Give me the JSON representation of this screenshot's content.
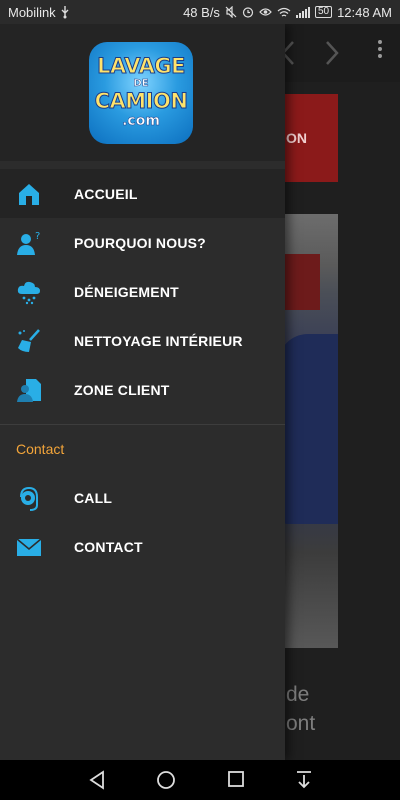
{
  "status_bar": {
    "carrier": "Mobilink",
    "speed": "48 B/s",
    "battery": "50",
    "time": "12:48 AM"
  },
  "logo": {
    "line1": "LAVAGE",
    "line2": "DE",
    "line3": "CAMION",
    "line4": ".com"
  },
  "drawer": {
    "items": [
      {
        "label": "ACCUEIL",
        "icon": "home-icon"
      },
      {
        "label": "POURQUOI NOUS?",
        "icon": "user-question-icon"
      },
      {
        "label": "DÉNEIGEMENT",
        "icon": "snow-cloud-icon"
      },
      {
        "label": "NETTOYAGE INTÉRIEUR",
        "icon": "broom-icon"
      },
      {
        "label": "ZONE CLIENT",
        "icon": "client-document-icon"
      }
    ],
    "contact_section": {
      "title": "Contact",
      "items": [
        {
          "label": "CALL",
          "icon": "call-headset-icon"
        },
        {
          "label": "CONTACT",
          "icon": "mail-icon"
        }
      ]
    }
  },
  "background": {
    "banner_text": "ON",
    "body_line1": "de",
    "body_line2": "ont"
  },
  "colors": {
    "accent_icon": "#29aee6",
    "section_title": "#f3a53a",
    "drawer_bg": "#2c2c2c",
    "banner_red": "#8b1a1a"
  }
}
